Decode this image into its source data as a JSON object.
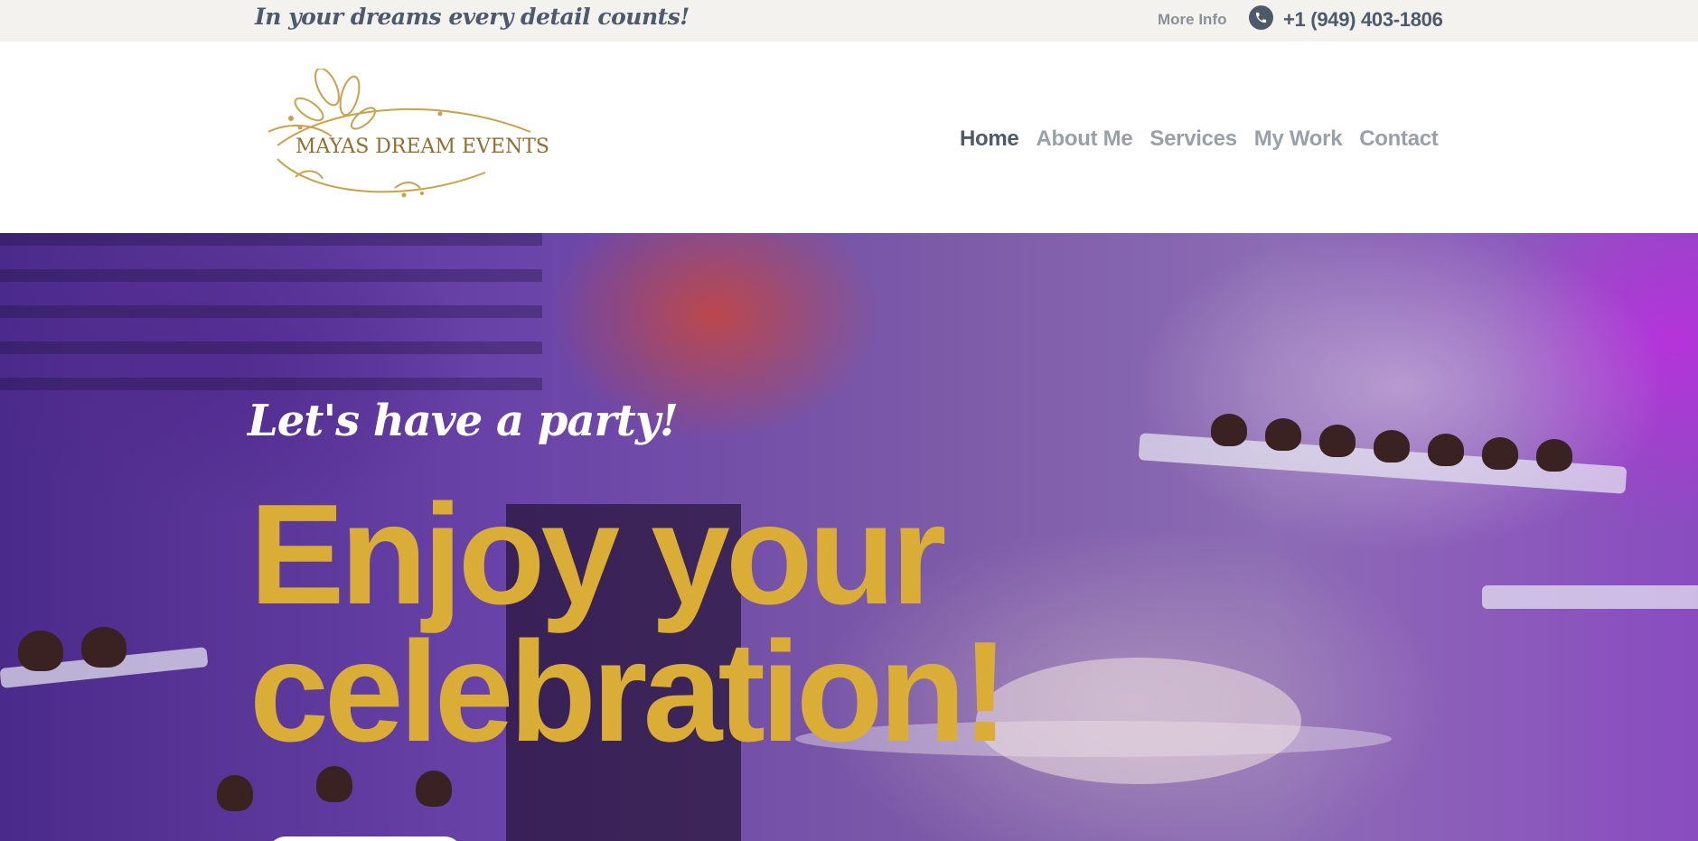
{
  "topbar": {
    "tagline": "In your dreams every detail counts!",
    "more_info": "More Info",
    "phone_icon": "phone-icon",
    "phone": "+1 (949) 403-1806"
  },
  "header": {
    "logo_text": "MAYAS DREAM EVENTS",
    "nav": [
      {
        "label": "Home",
        "active": true
      },
      {
        "label": "About Me",
        "active": false
      },
      {
        "label": "Services",
        "active": false
      },
      {
        "label": "My Work",
        "active": false
      },
      {
        "label": "Contact",
        "active": false
      }
    ]
  },
  "hero": {
    "subtitle": "Let's have a party!",
    "headline_line1": "Enjoy your",
    "headline_line2": "celebration!"
  },
  "colors": {
    "accent_gold": "#d9ad36",
    "text_slate": "#4d5a6c",
    "nav_inactive": "#9aa0a9",
    "topbar_bg": "#f3f2ee"
  }
}
